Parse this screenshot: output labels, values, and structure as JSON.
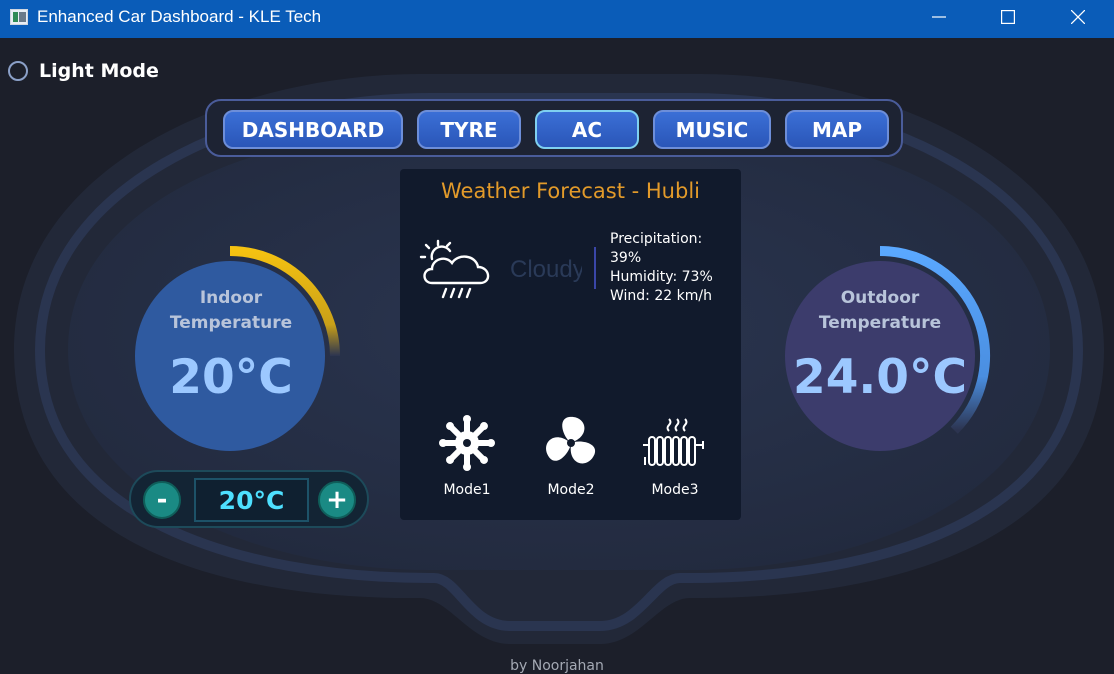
{
  "window": {
    "title": "Enhanced Car Dashboard - KLE Tech",
    "controls": [
      "minimize-icon",
      "maximize-icon",
      "close-icon"
    ]
  },
  "theme_toggle": {
    "label": "Light Mode",
    "checked": false
  },
  "nav": {
    "items": [
      {
        "label": "DASHBOARD",
        "active": false
      },
      {
        "label": "TYRE",
        "active": false
      },
      {
        "label": "AC",
        "active": true
      },
      {
        "label": "MUSIC",
        "active": false
      },
      {
        "label": "MAP",
        "active": false
      }
    ]
  },
  "indoor": {
    "label_line1": "Indoor",
    "label_line2": "Temperature",
    "value": "20°C",
    "arc_fraction": 0.25,
    "arc_color": "#f5c211"
  },
  "outdoor": {
    "label_line1": "Outdoor",
    "label_line2": "Temperature",
    "value": "24.0°C",
    "arc_fraction": 0.375,
    "arc_color": "#5aa8ff"
  },
  "stepper": {
    "minus_label": "-",
    "plus_label": "+",
    "value": "20°C"
  },
  "weather": {
    "title": "Weather Forecast - Hubli",
    "condition": "Cloudy",
    "icon": "cloud-rain-sun-icon",
    "precipitation_label": "Precipitation:",
    "precipitation_value": "39%",
    "humidity": "Humidity: 73%",
    "wind": "Wind: 22 km/h"
  },
  "modes": [
    {
      "label": "Mode1",
      "icon": "snowflake-icon"
    },
    {
      "label": "Mode2",
      "icon": "fan-icon"
    },
    {
      "label": "Mode3",
      "icon": "heater-icon"
    }
  ],
  "footer": "by Noorjahan",
  "colors": {
    "titlebar": "#0a5cb8",
    "background": "#1c1f2a",
    "accent_orange": "#e29a2a",
    "accent_cyan": "#4ee0ff"
  }
}
